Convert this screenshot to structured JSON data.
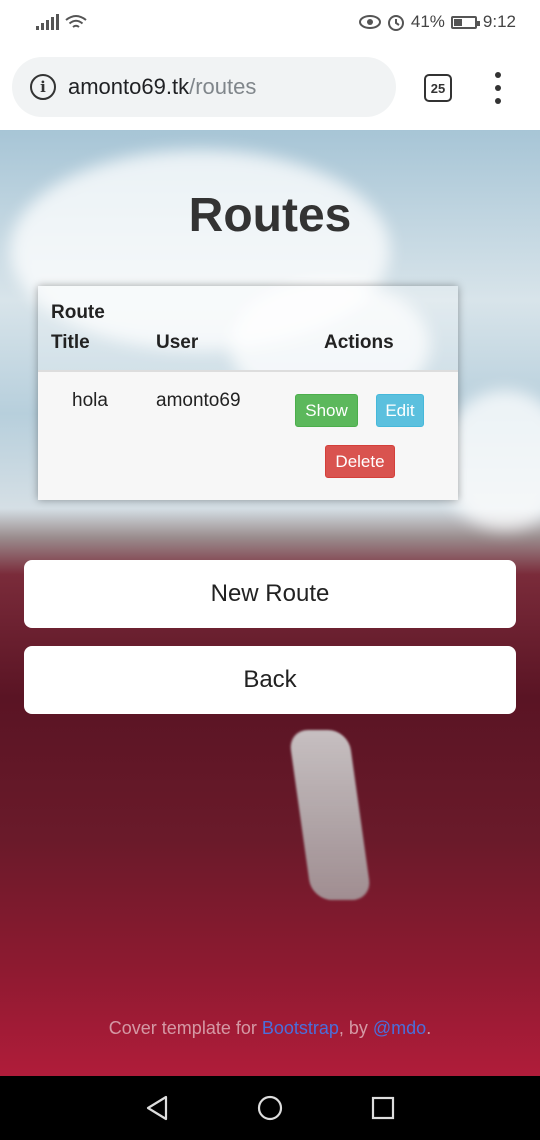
{
  "status_bar": {
    "battery": "41%",
    "battery_level": 0.41,
    "time": "9:12"
  },
  "browser": {
    "domain": "amonto69.tk",
    "path": "/routes",
    "tab_count": "25"
  },
  "page": {
    "title": "Routes",
    "table": {
      "headers": [
        "Route Title",
        "User",
        "Actions"
      ],
      "rows": [
        {
          "title": "hola",
          "user": "amonto69",
          "show": "Show",
          "edit": "Edit",
          "delete": "Delete"
        }
      ]
    },
    "new_route_label": "New Route",
    "back_label": "Back",
    "footer": {
      "prefix": "Cover template for ",
      "link1": "Bootstrap",
      "middle": ", by ",
      "link2": "@mdo",
      "suffix": "."
    }
  },
  "colors": {
    "show_button": "#5cb85c",
    "edit_button": "#5bc0de",
    "delete_button": "#d9534f",
    "link": "#4a6fdc"
  }
}
